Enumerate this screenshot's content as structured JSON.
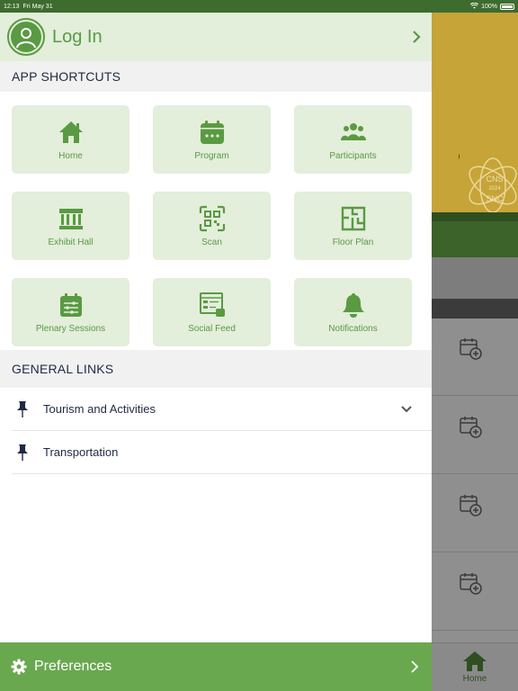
{
  "status_bar": {
    "time": "12:13",
    "date": "Fri May 31",
    "battery": "100%"
  },
  "login": {
    "label": "Log In"
  },
  "shortcuts": {
    "header": "APP SHORTCUTS",
    "items": [
      {
        "label": "Home",
        "icon": "home-icon"
      },
      {
        "label": "Program",
        "icon": "calendar-icon"
      },
      {
        "label": "Participants",
        "icon": "people-icon"
      },
      {
        "label": "Exhibit Hall",
        "icon": "building-icon"
      },
      {
        "label": "Scan",
        "icon": "qr-scan-icon"
      },
      {
        "label": "Floor Plan",
        "icon": "floor-plan-icon"
      },
      {
        "label": "Plenary Sessions",
        "icon": "sessions-icon"
      },
      {
        "label": "Social Feed",
        "icon": "social-feed-icon"
      },
      {
        "label": "Notifications",
        "icon": "bell-icon"
      }
    ]
  },
  "general_links": {
    "header": "GENERAL LINKS",
    "items": [
      {
        "label": "Tourism and Activities",
        "expandable": true
      },
      {
        "label": "Transportation",
        "expandable": false
      }
    ]
  },
  "preferences": {
    "label": "Preferences"
  },
  "background": {
    "logo_lines": [
      "CNS",
      "2024",
      "SNC"
    ],
    "tab_home": "Home"
  },
  "colors": {
    "accent": "#6aa84f",
    "tile_bg": "#e3eedb",
    "text_dark": "#1e2a44",
    "status_bar": "#3e6b2e"
  }
}
